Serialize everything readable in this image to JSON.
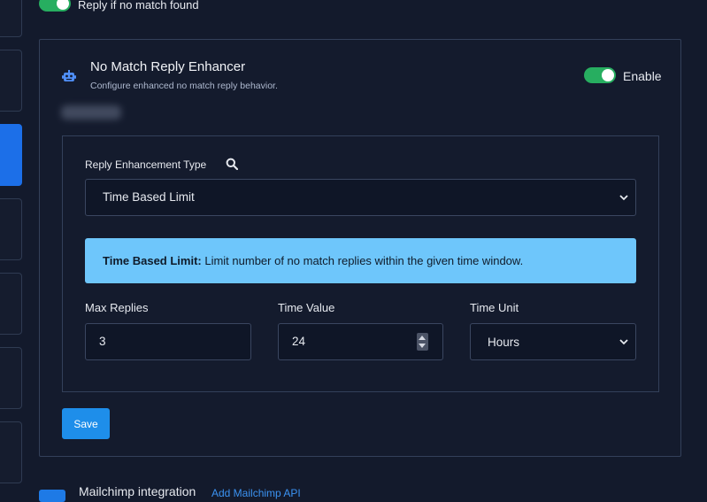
{
  "top_toggle": {
    "label": "Reply if no match found",
    "on": true
  },
  "card": {
    "title": "No Match Reply Enhancer",
    "subtitle": "Configure enhanced no match reply behavior.",
    "icon": "robot-icon",
    "enable_label": "Enable",
    "enabled": true,
    "type_label": "Reply Enhancement Type",
    "type_value": "Time Based Limit",
    "alert_title": "Time Based Limit:",
    "alert_text": " Limit number of no match replies within the given time window.",
    "max_replies_label": "Max Replies",
    "max_replies_value": "3",
    "time_value_label": "Time Value",
    "time_value_value": "24",
    "time_unit_label": "Time Unit",
    "time_unit_value": "Hours",
    "save_label": "Save"
  },
  "next_section": {
    "title": "Mailchimp integration",
    "link": "Add Mailchimp API"
  },
  "colors": {
    "background": "#131a2c",
    "accent": "#1e8eea",
    "toggle_on": "#27ae60",
    "alert_bg": "#6ec6fb",
    "robot_icon": "#4f8ef7"
  }
}
